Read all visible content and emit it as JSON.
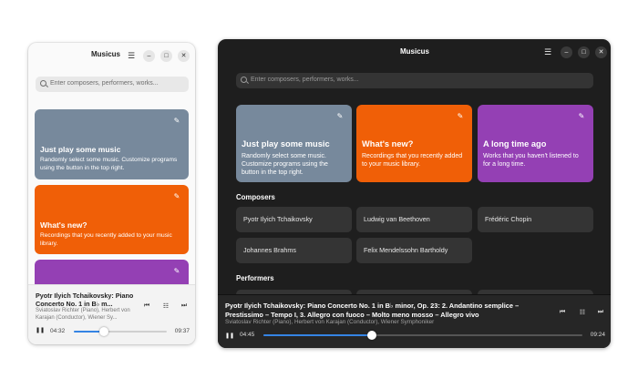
{
  "app": {
    "title": "Musicus"
  },
  "search": {
    "placeholder": "Enter composers, performers, works..."
  },
  "cards": [
    {
      "title": "Just play some music",
      "description": "Randomly select some music. Customize programs using the button in the top right.",
      "color": "#77899c"
    },
    {
      "title": "What's new?",
      "description": "Recordings that you recently added to your music library.",
      "color": "#f05f07"
    },
    {
      "title": "A long time ago",
      "description": "Works that you haven't listened to for a long time.",
      "color": "#9440b4"
    }
  ],
  "sections": {
    "composers": "Composers",
    "performers": "Performers"
  },
  "composers": [
    "Pyotr Ilyich Tchaikovsky",
    "Ludwig van Beethoven",
    "Frédéric Chopin",
    "Johannes Brahms",
    "Felix Mendelssohn Bartholdy"
  ],
  "player_light": {
    "title": "Pyotr Ilyich Tchaikovsky: Piano Concerto No. 1 in B♭ m...",
    "subtitle": "Sviatoslav Richter (Piano), Herbert von Karajan (Conductor), Wiener Sy...",
    "elapsed": "04:32",
    "total": "09:37",
    "progress": 0.32
  },
  "player_dark": {
    "title": "Pyotr Ilyich Tchaikovsky: Piano Concerto No. 1 in B♭ minor, Op. 23: 2. Andantino semplice – Prestissimo – Tempo I, 3. Allegro con fuoco – Molto meno mosso – Allegro vivo",
    "subtitle": "Sviatoslav Richter (Piano), Herbert von Karajan (Conductor), Wiener Symphoniker",
    "elapsed": "04:45",
    "total": "09:24",
    "progress": 0.34
  },
  "icons": {
    "menu": "☰",
    "minimize": "–",
    "maximize": "□",
    "close": "✕",
    "edit": "✎",
    "previous": "⏮",
    "playlist": "☷",
    "next": "⏭",
    "pause": "❚❚"
  },
  "colors": {
    "accent": "#3584e4"
  }
}
